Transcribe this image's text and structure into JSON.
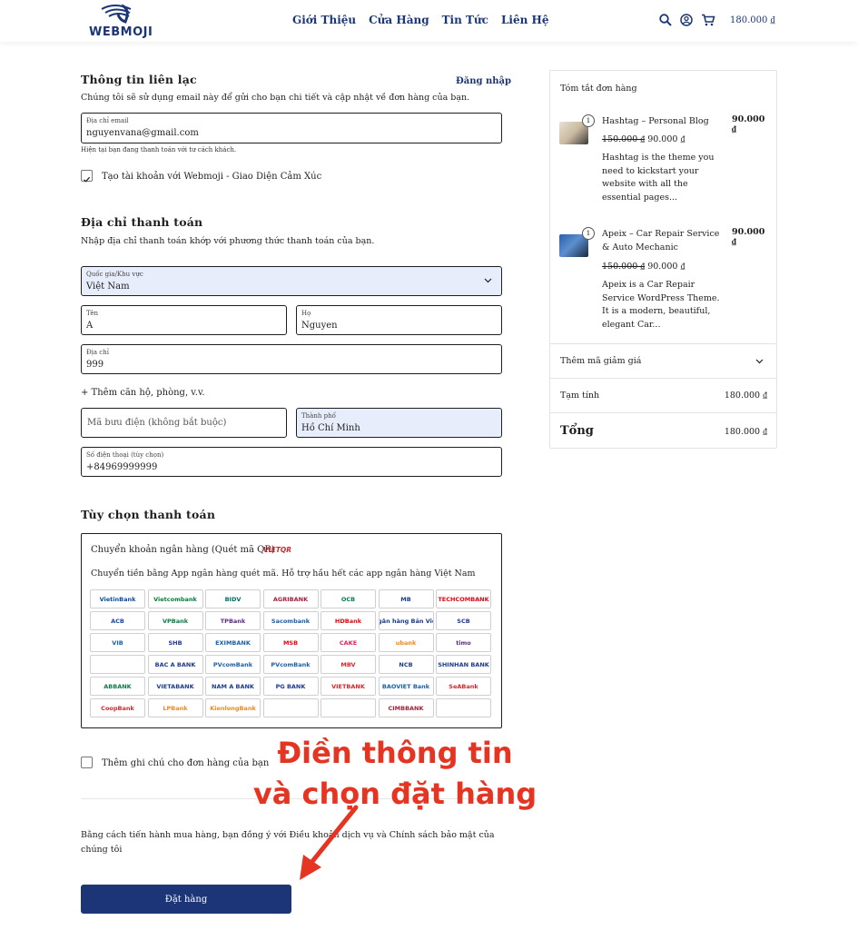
{
  "header": {
    "logo_text": "WEBMOJI",
    "nav": [
      "Giới Thiệu",
      "Cửa Hàng",
      "Tin Tức",
      "Liên Hệ"
    ],
    "cart_total": "180.000 ₫"
  },
  "contact": {
    "title": "Thông tin liên lạc",
    "login": "Đăng nhập",
    "desc": "Chúng tôi sẽ sử dụng email này để gửi cho bạn chi tiết và cập nhật về đơn hàng của bạn.",
    "email_label": "Địa chỉ email",
    "email_value": "nguyenvana@gmail.com",
    "guest_note": "Hiện tại bạn đang thanh toán với tư cách khách.",
    "create_account": "Tạo tài khoản với Webmoji - Giao Diện Cảm Xúc"
  },
  "billing": {
    "title": "Địa chỉ thanh toán",
    "desc": "Nhập địa chỉ thanh toán khớp với phương thức thanh toán của bạn.",
    "country_label": "Quốc gia/Khu vực",
    "country_value": "Việt Nam",
    "first_name_label": "Tên",
    "first_name_value": "A",
    "last_name_label": "Họ",
    "last_name_value": "Nguyen",
    "address_label": "Địa chỉ",
    "address_value": "999",
    "add_apartment": "+ Thêm căn hộ, phòng, v.v.",
    "postcode_placeholder": "Mã bưu điện (không bắt buộc)",
    "city_label": "Thành phố",
    "city_value": "Hồ Chí Minh",
    "phone_label": "Số điện thoại (tùy chọn)",
    "phone_value": "+84969999999"
  },
  "payment": {
    "title": "Tùy chọn thanh toán",
    "method": "Chuyển khoản ngân hàng (Quét mã QR)",
    "method_logo": "VIETQR",
    "desc": "Chuyển tiền bằng App ngân hàng quét mã. Hỗ trợ hầu hết các app ngân hàng Việt Nam",
    "banks": [
      {
        "name": "VietinBank",
        "color": "#0a4da2"
      },
      {
        "name": "Vietcombank",
        "color": "#0b7a3a"
      },
      {
        "name": "BIDV",
        "color": "#006b68"
      },
      {
        "name": "AGRIBANK",
        "color": "#a4203b"
      },
      {
        "name": "OCB",
        "color": "#0a7a46"
      },
      {
        "name": "MB",
        "color": "#1b3a8c"
      },
      {
        "name": "TECHCOMBANK",
        "color": "#e30613"
      },
      {
        "name": "ACB",
        "color": "#1a47a3"
      },
      {
        "name": "VPBank",
        "color": "#0a7a46"
      },
      {
        "name": "TPBank",
        "color": "#5a2d82"
      },
      {
        "name": "Sacombank",
        "color": "#1b5ea8"
      },
      {
        "name": "HDBank",
        "color": "#e30613"
      },
      {
        "name": "Ngân hàng Bản Việt",
        "color": "#1b3a8c"
      },
      {
        "name": "SCB",
        "color": "#1b3a8c"
      },
      {
        "name": "VIB",
        "color": "#1b5ea8"
      },
      {
        "name": "SHB",
        "color": "#1b3a8c"
      },
      {
        "name": "EXIMBANK",
        "color": "#1b5ea8"
      },
      {
        "name": "MSB",
        "color": "#e30613"
      },
      {
        "name": "CAKE",
        "color": "#e3245a"
      },
      {
        "name": "ubank",
        "color": "#f08a1c"
      },
      {
        "name": "timo",
        "color": "#5a2d82"
      },
      {
        "name": "",
        "color": "#1b5ea8"
      },
      {
        "name": "BAC A BANK",
        "color": "#1b3a8c"
      },
      {
        "name": "PVcomBank",
        "color": "#1b5ea8"
      },
      {
        "name": "PVcomBank",
        "color": "#1b5ea8"
      },
      {
        "name": "MBV",
        "color": "#d7262d"
      },
      {
        "name": "NCB",
        "color": "#1b3a8c"
      },
      {
        "name": "SHINHAN BANK",
        "color": "#1b3a8c"
      },
      {
        "name": "ABBANK",
        "color": "#0a7a46"
      },
      {
        "name": "VIETABANK",
        "color": "#1b3a8c"
      },
      {
        "name": "NAM A BANK",
        "color": "#1b3a8c"
      },
      {
        "name": "PG BANK",
        "color": "#1b3a8c"
      },
      {
        "name": "VIETBANK",
        "color": "#d7262d"
      },
      {
        "name": "BAOVIET Bank",
        "color": "#1b5ea8"
      },
      {
        "name": "SeABank",
        "color": "#d7262d"
      },
      {
        "name": "CoopBank",
        "color": "#d7262d"
      },
      {
        "name": "LPBank",
        "color": "#f08a1c"
      },
      {
        "name": "KienlongBank",
        "color": "#f08a1c"
      },
      {
        "name": "",
        "color": "#d7262d"
      },
      {
        "name": "",
        "color": "#0a7a46"
      },
      {
        "name": "CIMBBANK",
        "color": "#a4203b"
      },
      {
        "name": "",
        "color": "#1b5ea8"
      }
    ]
  },
  "notes": {
    "add_note": "Thêm ghi chú cho đơn hàng của bạn"
  },
  "terms": "Bằng cách tiến hành mua hàng, bạn đồng ý với Điều khoản dịch vụ và Chính sách bảo mật của chúng tôi",
  "place_order": "Đặt hàng",
  "annotation": {
    "line1": "Điền thông tin",
    "line2": "và chọn đặt hàng"
  },
  "summary": {
    "title": "Tóm tắt đơn hàng",
    "items": [
      {
        "qty": "1",
        "name": "Hashtag – Personal Blog",
        "price": "90.000 ₫",
        "old_price": "150.000 ₫",
        "new_price": "90.000 ₫",
        "desc": "Hashtag is the theme you need to kickstart your website with all the essential pages..."
      },
      {
        "qty": "1",
        "name": "Apeix – Car Repair Service & Auto Mechanic",
        "price": "90.000 ₫",
        "old_price": "150.000 ₫",
        "new_price": "90.000 ₫",
        "desc": "Apeix is a Car Repair Service WordPress Theme. It is a modern, beautiful, elegant Car..."
      }
    ],
    "coupon": "Thêm mã giảm giá",
    "subtotal_label": "Tạm tính",
    "subtotal_value": "180.000 ₫",
    "total_label": "Tổng",
    "total_value": "180.000 ₫"
  },
  "colors": {
    "brand": "#1b3577",
    "annotation": "#e63423",
    "filled_field": "#e8edfb"
  }
}
